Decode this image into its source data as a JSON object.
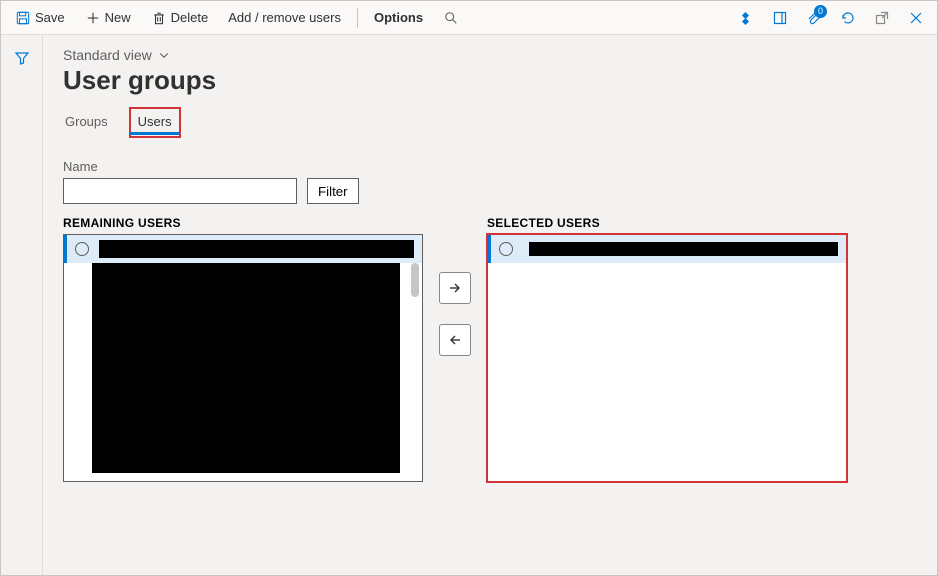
{
  "toolbar": {
    "save_label": "Save",
    "new_label": "New",
    "delete_label": "Delete",
    "addremove_label": "Add / remove users",
    "options_label": "Options",
    "attachments_count": "0"
  },
  "view": {
    "label": "Standard view"
  },
  "page": {
    "title": "User groups"
  },
  "tabs": {
    "groups": "Groups",
    "users": "Users"
  },
  "form": {
    "name_label": "Name",
    "name_value": "",
    "filter_label": "Filter"
  },
  "panels": {
    "remaining_title": "REMAINING USERS",
    "selected_title": "SELECTED USERS"
  }
}
